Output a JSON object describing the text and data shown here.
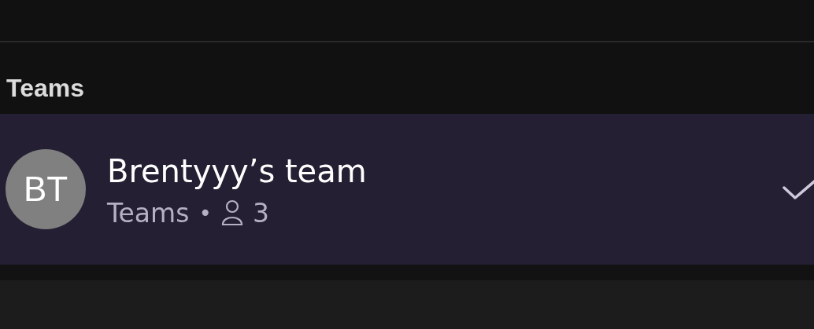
{
  "section": {
    "heading": "Teams"
  },
  "teams": [
    {
      "initials": "BT",
      "name": "Brentyyy’s team",
      "type": "Teams",
      "separator": "•",
      "members": "3",
      "selected": true
    }
  ]
}
